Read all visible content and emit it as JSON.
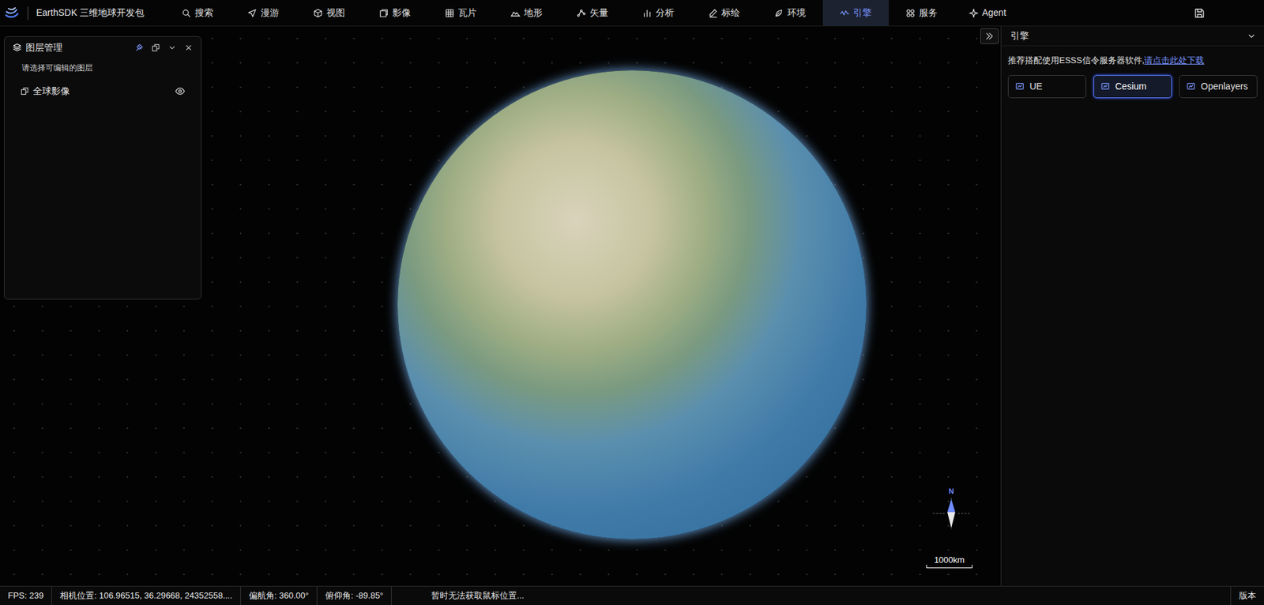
{
  "app": {
    "title": "EarthSDK 三维地球开发包"
  },
  "menu": [
    {
      "label": "搜索",
      "selected": false
    },
    {
      "label": "漫游",
      "selected": false
    },
    {
      "label": "视图",
      "selected": false
    },
    {
      "label": "影像",
      "selected": false
    },
    {
      "label": "瓦片",
      "selected": false
    },
    {
      "label": "地形",
      "selected": false
    },
    {
      "label": "矢量",
      "selected": false
    },
    {
      "label": "分析",
      "selected": false
    },
    {
      "label": "标绘",
      "selected": false
    },
    {
      "label": "环境",
      "selected": false
    },
    {
      "label": "引擎",
      "selected": true
    },
    {
      "label": "服务",
      "selected": false
    },
    {
      "label": "Agent",
      "selected": false
    }
  ],
  "layer_panel": {
    "title": "图层管理",
    "hint": "请选择可编辑的图层",
    "layers": [
      {
        "name": "全球影像",
        "visible": true
      }
    ]
  },
  "engine_panel": {
    "title": "引擎",
    "notice": "推荐搭配使用ESSS信令服务器软件,",
    "link": "请点击此处下载",
    "engines": [
      {
        "label": "UE",
        "selected": false
      },
      {
        "label": "Cesium",
        "selected": true
      },
      {
        "label": "Openlayers",
        "selected": false
      }
    ]
  },
  "map": {
    "compass": "N",
    "scale": "1000km"
  },
  "status_bar": {
    "items": [
      "FPS: 239",
      "相机位置: 106.96515, 36.29668, 24352558....",
      "偏航角: 360.00°",
      "俯仰角: -89.85°"
    ],
    "mouse": "暂时无法获取鼠标位置...",
    "version": "版本"
  }
}
